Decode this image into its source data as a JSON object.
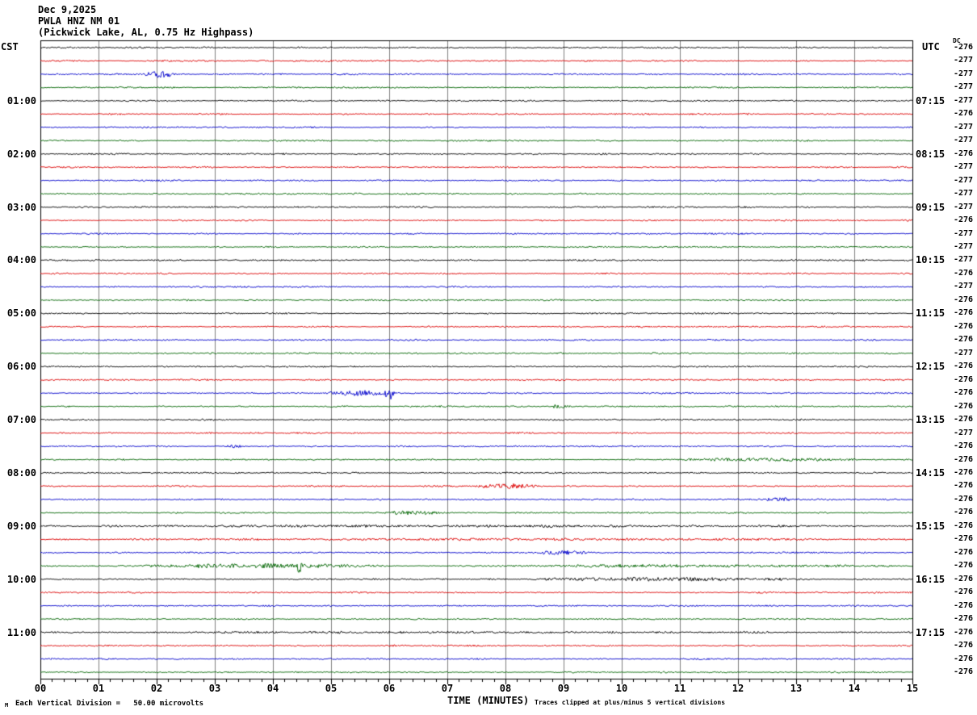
{
  "title": {
    "date": "Dec 9,2025",
    "station": "PWLA HNZ NM 01",
    "description": "(Pickwick Lake, AL, 0.75 Hz Highpass)"
  },
  "corner_glyph": "M",
  "footer": {
    "scale_note": "Each Vertical Division =   50.00 microvolts",
    "clip_note": "Traces clipped at plus/minus 5 vertical divisions"
  },
  "chart_data": {
    "type": "line",
    "subtype": "helicorder-seismogram",
    "left_axis_label": "CST",
    "right_axis_label": "UTC",
    "dc_column_header": "DC",
    "x_axis": {
      "title": "TIME (MINUTES)",
      "range_minutes": [
        0,
        15
      ],
      "tick_labels": [
        "00",
        "01",
        "02",
        "03",
        "04",
        "05",
        "06",
        "07",
        "08",
        "09",
        "10",
        "11",
        "12",
        "13",
        "14",
        "15"
      ],
      "gridline_every_minutes": 1,
      "minor_ticks_per_major": 4
    },
    "minutes_per_row": 15,
    "grid_color": "#808080",
    "colors": {
      "black": "#000000",
      "red": "#dd0000",
      "blue": "#0000cc",
      "green": "#006400"
    },
    "trace_color_cycle": [
      "black",
      "red",
      "blue",
      "green"
    ],
    "rows": [
      {
        "color": "black",
        "dc": "-276"
      },
      {
        "color": "red",
        "dc": "-277"
      },
      {
        "color": "blue",
        "dc": "-277"
      },
      {
        "color": "green",
        "dc": "-277"
      },
      {
        "color": "black",
        "dc": "-277",
        "cst": "01:00",
        "utc": "07:15"
      },
      {
        "color": "red",
        "dc": "-276"
      },
      {
        "color": "blue",
        "dc": "-277"
      },
      {
        "color": "green",
        "dc": "-277"
      },
      {
        "color": "black",
        "dc": "-276",
        "cst": "02:00",
        "utc": "08:15"
      },
      {
        "color": "red",
        "dc": "-277"
      },
      {
        "color": "blue",
        "dc": "-277"
      },
      {
        "color": "green",
        "dc": "-277"
      },
      {
        "color": "black",
        "dc": "-277",
        "cst": "03:00",
        "utc": "09:15"
      },
      {
        "color": "red",
        "dc": "-276"
      },
      {
        "color": "blue",
        "dc": "-277"
      },
      {
        "color": "green",
        "dc": "-277"
      },
      {
        "color": "black",
        "dc": "-277",
        "cst": "04:00",
        "utc": "10:15"
      },
      {
        "color": "red",
        "dc": "-276"
      },
      {
        "color": "blue",
        "dc": "-277"
      },
      {
        "color": "green",
        "dc": "-276"
      },
      {
        "color": "black",
        "dc": "-276",
        "cst": "05:00",
        "utc": "11:15"
      },
      {
        "color": "red",
        "dc": "-276"
      },
      {
        "color": "blue",
        "dc": "-276"
      },
      {
        "color": "green",
        "dc": "-277"
      },
      {
        "color": "black",
        "dc": "-276",
        "cst": "06:00",
        "utc": "12:15"
      },
      {
        "color": "red",
        "dc": "-276"
      },
      {
        "color": "blue",
        "dc": "-276"
      },
      {
        "color": "green",
        "dc": "-276"
      },
      {
        "color": "black",
        "dc": "-276",
        "cst": "07:00",
        "utc": "13:15"
      },
      {
        "color": "red",
        "dc": "-277"
      },
      {
        "color": "blue",
        "dc": "-276"
      },
      {
        "color": "green",
        "dc": "-276"
      },
      {
        "color": "black",
        "dc": "-276",
        "cst": "08:00",
        "utc": "14:15"
      },
      {
        "color": "red",
        "dc": "-276"
      },
      {
        "color": "blue",
        "dc": "-276"
      },
      {
        "color": "green",
        "dc": "-276"
      },
      {
        "color": "black",
        "dc": "-276",
        "cst": "09:00",
        "utc": "15:15"
      },
      {
        "color": "red",
        "dc": "-276"
      },
      {
        "color": "blue",
        "dc": "-276"
      },
      {
        "color": "green",
        "dc": "-276"
      },
      {
        "color": "black",
        "dc": "-276",
        "cst": "10:00",
        "utc": "16:15"
      },
      {
        "color": "red",
        "dc": "-276"
      },
      {
        "color": "blue",
        "dc": "-276"
      },
      {
        "color": "green",
        "dc": "-276"
      },
      {
        "color": "black",
        "dc": "-276",
        "cst": "11:00",
        "utc": "17:15"
      },
      {
        "color": "red",
        "dc": "-276"
      },
      {
        "color": "blue",
        "dc": "-276"
      },
      {
        "color": "green",
        "dc": "-276"
      }
    ],
    "events": [
      {
        "row": 2,
        "start": 1.75,
        "end": 2.35,
        "amp": 3.5
      },
      {
        "row": 26,
        "start": 4.85,
        "end": 6.15,
        "amp": 3.0,
        "spike_at": 6.0,
        "spike_amp": 9
      },
      {
        "row": 27,
        "start": 8.7,
        "end": 9.15,
        "amp": 1.8
      },
      {
        "row": 30,
        "start": 3.15,
        "end": 3.55,
        "amp": 1.8
      },
      {
        "row": 31,
        "start": 10.7,
        "end": 14.2,
        "amp": 1.4
      },
      {
        "row": 33,
        "start": 7.4,
        "end": 8.7,
        "amp": 2.6
      },
      {
        "row": 34,
        "start": 12.4,
        "end": 12.95,
        "amp": 2.0
      },
      {
        "row": 35,
        "start": 5.85,
        "end": 6.95,
        "amp": 2.0
      },
      {
        "row": 36,
        "start": 0.1,
        "end": 14.9,
        "amp": 0.7
      },
      {
        "row": 37,
        "start": 0.1,
        "end": 14.9,
        "amp": 0.6
      },
      {
        "row": 38,
        "start": 8.4,
        "end": 9.6,
        "amp": 2.2
      },
      {
        "row": 39,
        "start": 1.6,
        "end": 6.0,
        "amp": 2.2,
        "spike_at": 4.45,
        "spike_amp": 6
      },
      {
        "row": 39,
        "start": 7.5,
        "end": 14.9,
        "amp": 1.2
      },
      {
        "row": 40,
        "start": 8.1,
        "end": 13.3,
        "amp": 1.8
      },
      {
        "row": 44,
        "start": 0.1,
        "end": 14.9,
        "amp": 0.5
      }
    ]
  }
}
